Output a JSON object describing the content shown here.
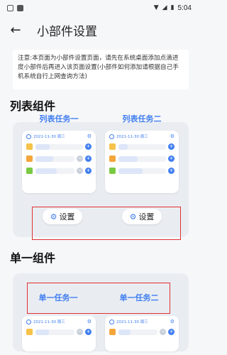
{
  "status": {
    "time": "5:04"
  },
  "appbar": {
    "title": "小部件设置"
  },
  "notice": {
    "text": "注意:本页面为小部件设置页面，请先在系统桌面添加点滴进度小部件后再进入该页面设置(小部件如何添加请根据自己手机系统自行上网查询方法)"
  },
  "list_section": {
    "title": "列表组件",
    "task1": "列表任务一",
    "task2": "列表任务二",
    "widget1_date": "2021-11-30 周三",
    "widget2_date": "2021-11-30 周三",
    "settings_label": "设置"
  },
  "single_section": {
    "title": "单一组件",
    "task1": "单一任务一",
    "task2": "单一任务二",
    "widget1_date": "2021-11-30 周三",
    "widget2_date": "2021-11-30 周三"
  },
  "colors": {
    "accent": "#3f7df0",
    "highlight": "#e03030"
  }
}
